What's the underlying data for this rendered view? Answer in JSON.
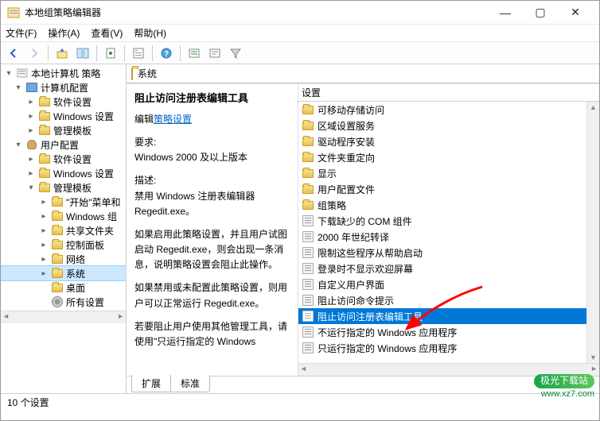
{
  "window": {
    "title": "本地组策略编辑器",
    "buttons": {
      "min": "—",
      "max": "▢",
      "close": "✕"
    }
  },
  "menu": {
    "file": "文件(F)",
    "action": "操作(A)",
    "view": "查看(V)",
    "help": "帮助(H)"
  },
  "tree": {
    "root": "本地计算机 策略",
    "computer": "计算机配置",
    "computer_children": [
      "软件设置",
      "Windows 设置",
      "管理模板"
    ],
    "user": "用户配置",
    "user_children": [
      "软件设置",
      "Windows 设置"
    ],
    "admin_templates": "管理模板",
    "admin_children": [
      "\"开始\"菜单和",
      "Windows 组",
      "共享文件夹",
      "控制面板",
      "网络",
      "系统",
      "桌面",
      "所有设置"
    ]
  },
  "pathbar": {
    "label": "系统"
  },
  "detail": {
    "title": "阻止访问注册表编辑工具",
    "edit_prefix": "编辑",
    "edit_link": "策略设置",
    "req_label": "要求:",
    "req_value": "Windows 2000 及以上版本",
    "desc_label": "描述:",
    "desc_p1": "禁用 Windows 注册表编辑器 Regedit.exe。",
    "desc_p2": "如果启用此策略设置，并且用户试图启动 Regedit.exe，则会出现一条消息，说明策略设置会阻止此操作。",
    "desc_p3": "如果禁用或未配置此策略设置，则用户可以正常运行 Regedit.exe。",
    "desc_p4": "若要阻止用户使用其他管理工具，请使用\"只运行指定的 Windows"
  },
  "list": {
    "header": "设置",
    "folders": [
      "可移动存储访问",
      "区域设置服务",
      "驱动程序安装",
      "文件夹重定向",
      "显示",
      "用户配置文件",
      "组策略"
    ],
    "policies": [
      "下载缺少的 COM 组件",
      "2000 年世纪转译",
      "限制这些程序从帮助启动",
      "登录时不显示欢迎屏幕",
      "自定义用户界面",
      "阻止访问命令提示",
      "阻止访问注册表编辑工具",
      "不运行指定的 Windows 应用程序",
      "只运行指定的 Windows 应用程序"
    ],
    "selected_index": 6
  },
  "tabs": {
    "extended": "扩展",
    "standard": "标准"
  },
  "status": {
    "text": "10 个设置"
  },
  "watermark": {
    "brand": "极光下载站",
    "url": "www.xz7.com"
  }
}
